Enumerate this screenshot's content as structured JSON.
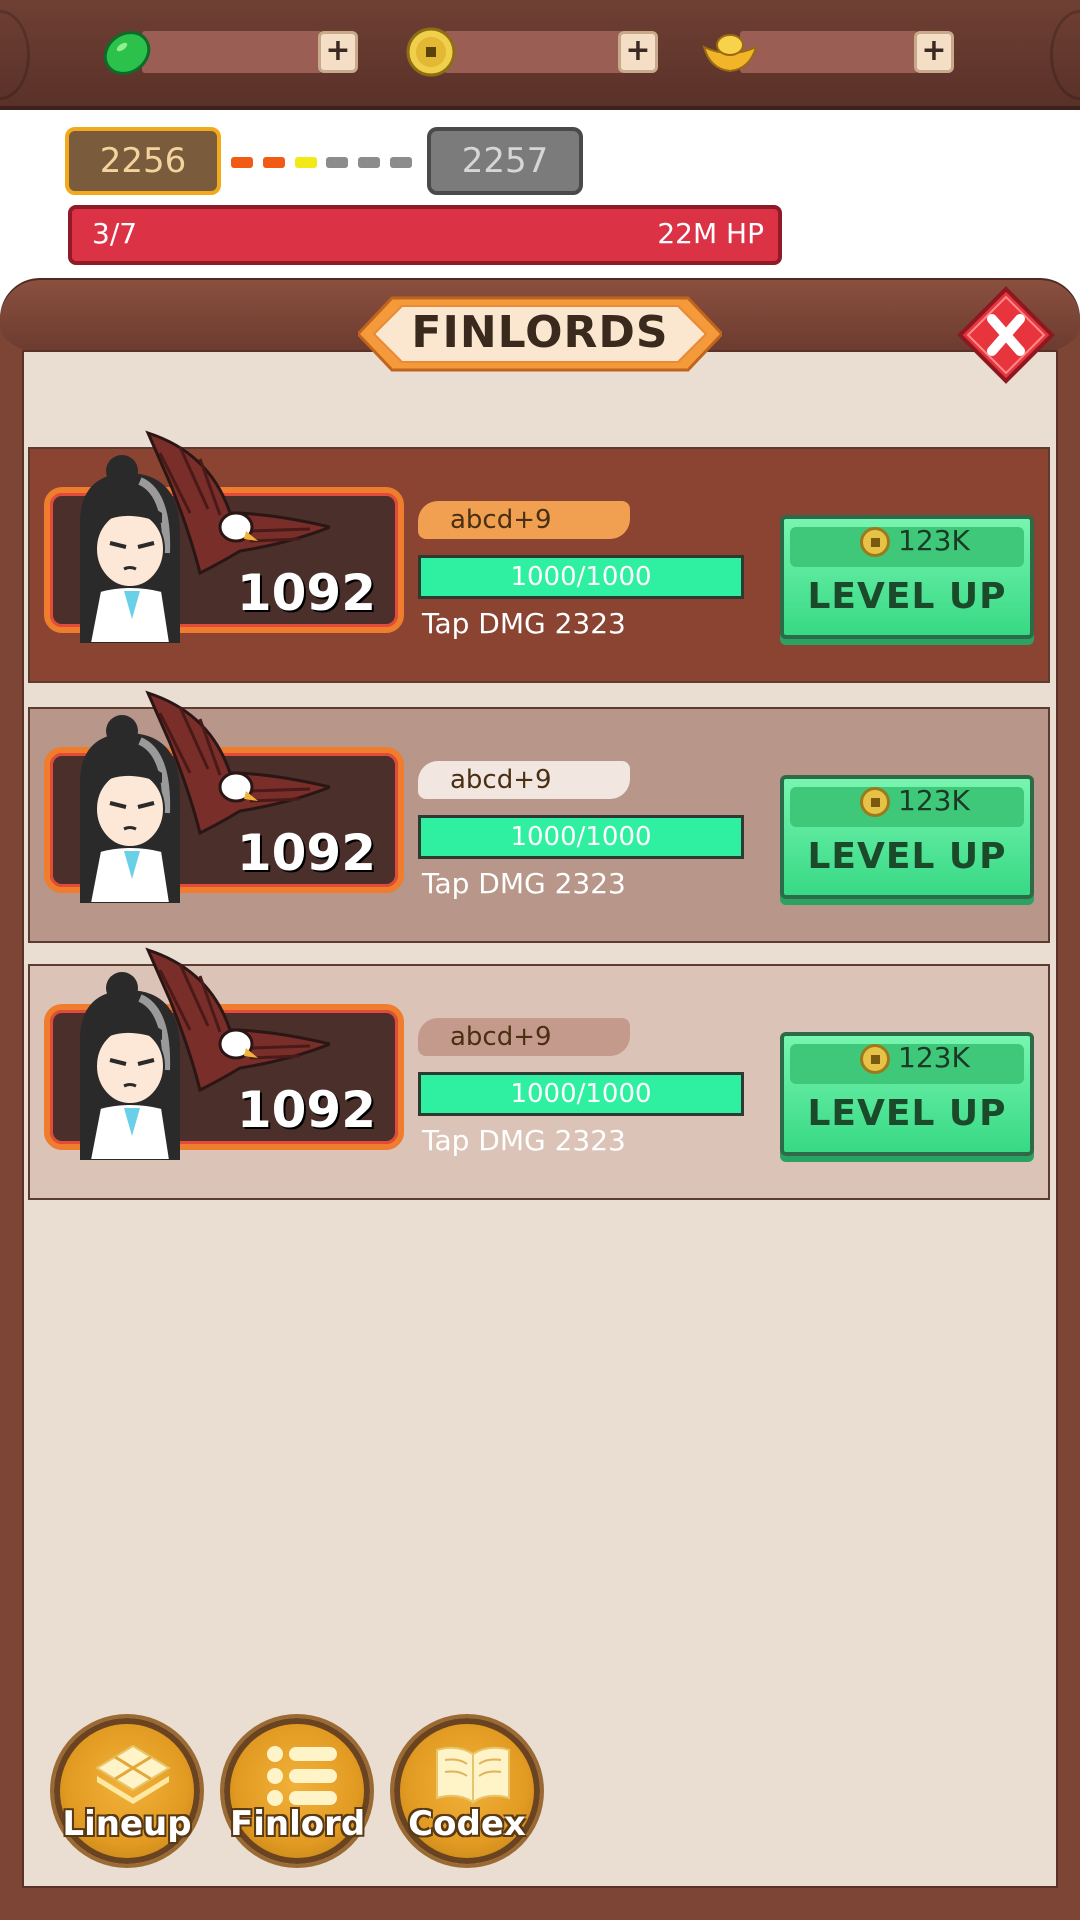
{
  "currencies": [
    {
      "name": "jade",
      "icon": "jade-icon",
      "value": ""
    },
    {
      "name": "coin",
      "icon": "coin-icon",
      "value": ""
    },
    {
      "name": "ingot",
      "icon": "gold-ingot-icon",
      "value": ""
    }
  ],
  "plus_label": "+",
  "stage": {
    "current": "2256",
    "next": "2257",
    "progress_dots": [
      "#f25b16",
      "#f25b16",
      "#f2ea16",
      "#8c8c8c",
      "#8c8c8c",
      "#8c8c8c"
    ]
  },
  "boss": {
    "wave": "3/7",
    "hp": "22M HP"
  },
  "panel": {
    "title": "FINLORDS",
    "close_icon": "close-x-icon"
  },
  "heroes": [
    {
      "name": "abcd+9",
      "power": "1092",
      "xp": "1000/1000",
      "dmg": "Tap DMG 2323",
      "cost": "123K",
      "button": "LEVEL UP"
    },
    {
      "name": "abcd+9",
      "power": "1092",
      "xp": "1000/1000",
      "dmg": "Tap DMG 2323",
      "cost": "123K",
      "button": "LEVEL UP"
    },
    {
      "name": "abcd+9",
      "power": "1092",
      "xp": "1000/1000",
      "dmg": "Tap DMG 2323",
      "cost": "123K",
      "button": "LEVEL UP"
    }
  ],
  "nav": [
    {
      "label": "Lineup",
      "icon": "lineup-icon"
    },
    {
      "label": "Finlord",
      "icon": "list-icon"
    },
    {
      "label": "Codex",
      "icon": "book-icon"
    }
  ],
  "colors": {
    "accent_green": "#37d985",
    "hp_red": "#dc3245",
    "frame_brown": "#7c4536"
  }
}
